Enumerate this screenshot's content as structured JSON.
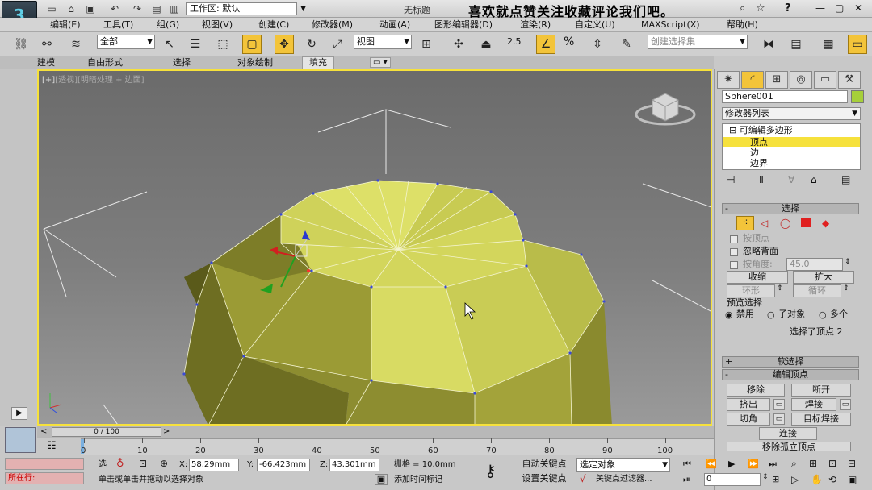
{
  "title_bar": {
    "logo": "3",
    "workspace": "工作区: 默认",
    "document_title": "无标题",
    "banner": "喜欢就点赞关注收藏评论我们吧。",
    "help_glyph": "?",
    "search_icon": "search-icon",
    "star_icon": "star-icon"
  },
  "menu": [
    "编辑(E)",
    "工具(T)",
    "组(G)",
    "视图(V)",
    "创建(C)",
    "修改器(M)",
    "动画(A)",
    "图形编辑器(D)",
    "渲染(R)",
    "自定义(U)",
    "MAXScript(X)",
    "帮助(H)"
  ],
  "toolbar": {
    "filter": "全部",
    "ref_coord": "视图",
    "snap_25": "2.5",
    "percent": "%",
    "named_sel": "创建选择集"
  },
  "ribbon_tabs": [
    "建模",
    "自由形式",
    "选择",
    "对象绘制",
    "填充"
  ],
  "viewport": {
    "label_bracket": "[+]",
    "label_view": "[透视]",
    "label_mode": "[明暗处理 + 边面]"
  },
  "command_panel": {
    "object_name": "Sphere001",
    "object_color": "#a6cf3a",
    "modifier_list": "修改器列表",
    "stack": [
      "可编辑多边形",
      "顶点",
      "边",
      "边界"
    ],
    "selection": {
      "title": "选择",
      "by_vertex": "按顶点",
      "ignore_backfacing": "忽略背面",
      "by_angle": "按角度:",
      "angle_value": "45.0",
      "shrink": "收缩",
      "grow": "扩大",
      "ring": "环形",
      "loop": "循环",
      "preview_title": "预览选择",
      "disabled": "禁用",
      "sub_object": "子对象",
      "multi": "多个",
      "status": "选择了顶点 2"
    },
    "soft_selection": "软选择",
    "edit_vertices": {
      "title": "编辑顶点",
      "remove": "移除",
      "break": "断开",
      "extrude": "挤出",
      "weld": "焊接",
      "chamfer": "切角",
      "target_weld": "目标焊接",
      "connect": "连接",
      "remove_isolated": "移除孤立顶点"
    }
  },
  "timeline": {
    "frame": "0 / 100",
    "ticks": [
      "0",
      "10",
      "20",
      "30",
      "40",
      "50",
      "60",
      "70",
      "80",
      "90",
      "100"
    ]
  },
  "status": {
    "listener": "所在行:",
    "mode": "选",
    "x_label": "X:",
    "x": "58.29mm",
    "y_label": "Y:",
    "y": "-66.423mm",
    "z_label": "Z:",
    "z": "43.301mm",
    "grid": "栅格 = 10.0mm",
    "prompt": "单击或单击并拖动以选择对象",
    "add_time_tag": "添加时间标记",
    "auto_key": "自动关键点",
    "selected_object": "选定对象",
    "set_key": "设置关键点",
    "key_filters": "关键点过滤器...",
    "current_frame": "0"
  }
}
